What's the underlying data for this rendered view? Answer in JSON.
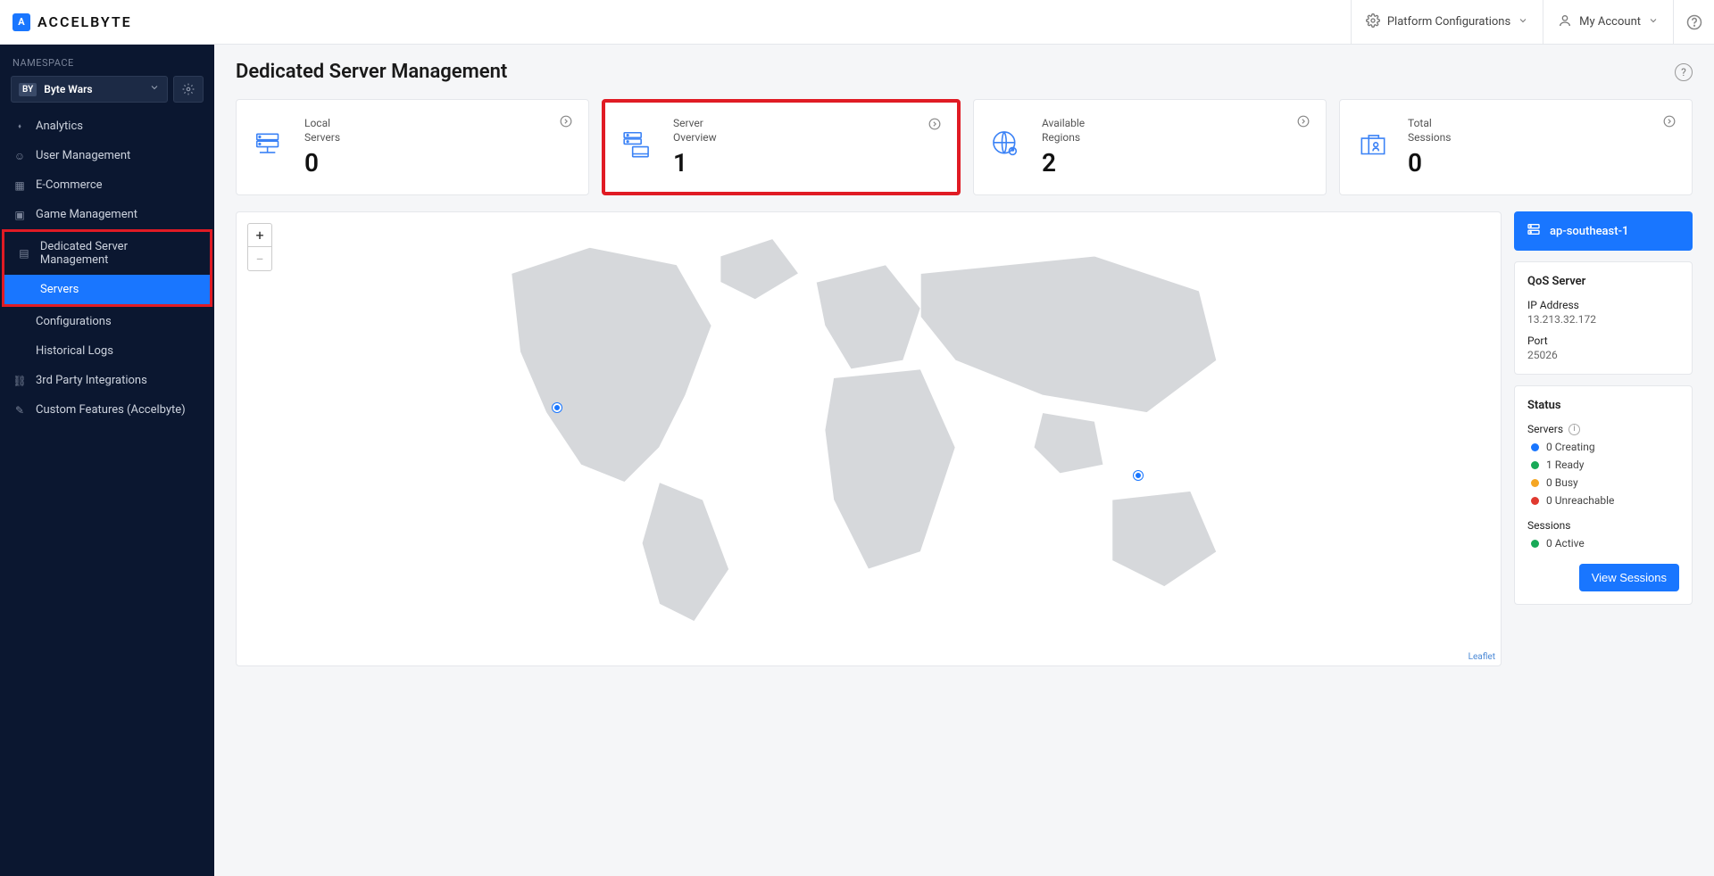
{
  "brand": "ACCELBYTE",
  "topbar": {
    "platform": "Platform Configurations",
    "account": "My Account"
  },
  "sidebar": {
    "ns_label": "NAMESPACE",
    "ns_badge": "BY",
    "ns_name": "Byte Wars",
    "items": {
      "analytics": "Analytics",
      "user_mgmt": "User Management",
      "ecommerce": "E-Commerce",
      "game_mgmt": "Game Management",
      "dsm": "Dedicated Server Management",
      "servers": "Servers",
      "configs": "Configurations",
      "hist_logs": "Historical Logs",
      "third_party": "3rd Party Integrations",
      "custom_feat": "Custom Features (Accelbyte)"
    }
  },
  "page": {
    "title": "Dedicated Server Management"
  },
  "stats": {
    "local": {
      "label1": "Local",
      "label2": "Servers",
      "value": "0"
    },
    "overview": {
      "label1": "Server",
      "label2": "Overview",
      "value": "1"
    },
    "regions": {
      "label1": "Available",
      "label2": "Regions",
      "value": "2"
    },
    "sessions": {
      "label1": "Total",
      "label2": "Sessions",
      "value": "0"
    }
  },
  "map": {
    "zoom_in": "+",
    "zoom_out": "−",
    "attribution": "Leaflet"
  },
  "region_selected": "ap-southeast-1",
  "qos": {
    "title": "QoS Server",
    "ip_label": "IP Address",
    "ip_value": "13.213.32.172",
    "port_label": "Port",
    "port_value": "25026"
  },
  "status": {
    "title": "Status",
    "servers_label": "Servers",
    "creating": "0 Creating",
    "ready": "1 Ready",
    "busy": "0 Busy",
    "unreachable": "0 Unreachable",
    "sessions_label": "Sessions",
    "active": "0 Active",
    "view_btn": "View Sessions"
  }
}
